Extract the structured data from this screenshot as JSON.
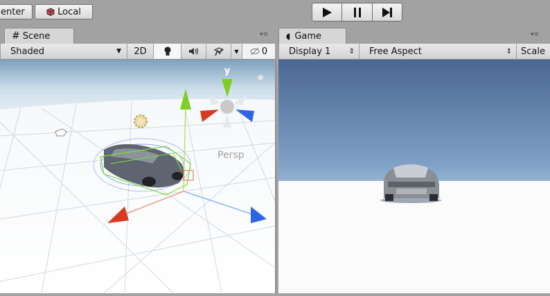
{
  "top_toolbar": {
    "pivot_label": "enter",
    "space_label": "Local"
  },
  "playback": {
    "play_icon": "play-icon",
    "pause_icon": "pause-icon",
    "step_icon": "step-icon"
  },
  "scene_panel": {
    "tab_label": "Scene",
    "shading_mode": "Shaded",
    "mode_2d_label": "2D",
    "hidden_count": "0",
    "projection_label": "Persp",
    "gizmo_axis_label": "y"
  },
  "game_panel": {
    "tab_label": "Game",
    "display": "Display 1",
    "aspect": "Free Aspect",
    "scale_label": "Scale"
  },
  "colors": {
    "axis_x": "#d8391f",
    "axis_y": "#7fcf22",
    "axis_z": "#2d64e6",
    "selection_wire": "#7ddc3a"
  }
}
